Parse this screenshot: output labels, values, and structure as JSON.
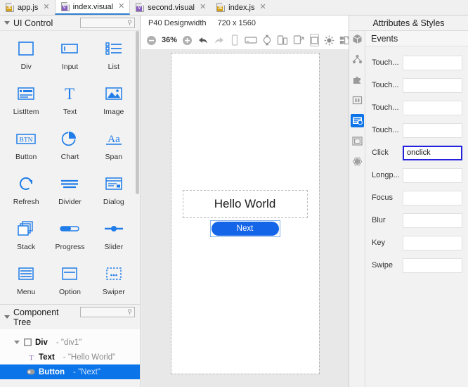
{
  "tabs": [
    {
      "label": "app.js",
      "icon": "js-file-icon",
      "badge": "JS",
      "active": false
    },
    {
      "label": "index.visual",
      "icon": "visual-file-icon",
      "badge": "V",
      "active": true
    },
    {
      "label": "second.visual",
      "icon": "visual-file-icon",
      "badge": "V",
      "active": false
    },
    {
      "label": "index.js",
      "icon": "js-file-icon",
      "badge": "JS",
      "active": false
    }
  ],
  "left_panel": {
    "title": "UI Control",
    "search_placeholder": "",
    "controls": [
      {
        "name": "Div",
        "icon": "div-icon"
      },
      {
        "name": "Input",
        "icon": "input-icon"
      },
      {
        "name": "List",
        "icon": "list-icon"
      },
      {
        "name": "ListItem",
        "icon": "listitem-icon"
      },
      {
        "name": "Text",
        "icon": "text-icon"
      },
      {
        "name": "Image",
        "icon": "image-icon"
      },
      {
        "name": "Button",
        "icon": "button-icon"
      },
      {
        "name": "Chart",
        "icon": "chart-icon"
      },
      {
        "name": "Span",
        "icon": "span-icon"
      },
      {
        "name": "Refresh",
        "icon": "refresh-icon"
      },
      {
        "name": "Divider",
        "icon": "divider-icon"
      },
      {
        "name": "Dialog",
        "icon": "dialog-icon"
      },
      {
        "name": "Stack",
        "icon": "stack-icon"
      },
      {
        "name": "Progress",
        "icon": "progress-icon"
      },
      {
        "name": "Slider",
        "icon": "slider-icon"
      },
      {
        "name": "Menu",
        "icon": "menu-icon"
      },
      {
        "name": "Option",
        "icon": "option-icon"
      },
      {
        "name": "Swiper",
        "icon": "swiper-icon"
      },
      {
        "name": "",
        "icon": "toolbar-icon"
      },
      {
        "name": "",
        "icon": "popup-icon"
      },
      {
        "name": "",
        "icon": "gauge-icon"
      }
    ]
  },
  "component_tree": {
    "title": "Component Tree",
    "search_placeholder": "",
    "rows": [
      {
        "type": "Div",
        "value": "- \"div1\"",
        "icon": "div-node-icon",
        "indent": 0,
        "selected": false,
        "has_caret": true
      },
      {
        "type": "Text",
        "value": "- \"Hello World\"",
        "icon": "text-node-icon",
        "indent": 1,
        "selected": false,
        "has_caret": false
      },
      {
        "type": "Button",
        "value": "- \"Next\"",
        "icon": "button-node-icon",
        "indent": 1,
        "selected": true,
        "has_caret": false
      }
    ]
  },
  "center": {
    "device_name": "P40 Designwidth",
    "device_size": "720 x 1560",
    "zoom": "36%",
    "toolbar": [
      {
        "name": "zoom-out-button",
        "icon": "minus-circle-icon"
      },
      {
        "name": "zoom-level",
        "icon": "zoom-label"
      },
      {
        "name": "zoom-in-button",
        "icon": "plus-circle-icon"
      },
      {
        "name": "undo-button",
        "icon": "undo-arrow-icon"
      },
      {
        "name": "redo-button",
        "icon": "redo-arrow-icon"
      },
      {
        "name": "phone-portrait-button",
        "icon": "phone-portrait-icon"
      },
      {
        "name": "phone-landscape-button",
        "icon": "phone-landscape-icon"
      },
      {
        "name": "watch-button",
        "icon": "watch-icon"
      },
      {
        "name": "foldable-button",
        "icon": "foldable-phone-icon"
      },
      {
        "name": "multi-screen-button",
        "icon": "multi-screen-icon"
      },
      {
        "name": "fullscreen-button",
        "icon": "square-outline-icon"
      },
      {
        "name": "brightness-button",
        "icon": "sun-icon"
      },
      {
        "name": "layout-button",
        "icon": "layout-grid-icon"
      }
    ],
    "preview": {
      "text_label": "Hello World",
      "button_label": "Next"
    }
  },
  "right_panel": {
    "title": "Attributes & Styles",
    "rail": [
      {
        "name": "component-icon",
        "active": false
      },
      {
        "name": "structure-icon",
        "active": false
      },
      {
        "name": "puzzle-icon",
        "active": false
      },
      {
        "name": "columns-icon",
        "active": false
      },
      {
        "name": "events-icon",
        "active": true
      },
      {
        "name": "frame-icon",
        "active": false
      },
      {
        "name": "atom-icon",
        "active": false
      }
    ],
    "section_title": "Events",
    "fields": [
      {
        "label": "Touch...",
        "value": "",
        "focused": false
      },
      {
        "label": "Touch...",
        "value": "",
        "focused": false
      },
      {
        "label": "Touch...",
        "value": "",
        "focused": false
      },
      {
        "label": "Touch...",
        "value": "",
        "focused": false
      },
      {
        "label": "Click",
        "value": "onclick",
        "focused": true
      },
      {
        "label": "Longp...",
        "value": "",
        "focused": false
      },
      {
        "label": "Focus",
        "value": "",
        "focused": false
      },
      {
        "label": "Blur",
        "value": "",
        "focused": false
      },
      {
        "label": "Key",
        "value": "",
        "focused": false
      },
      {
        "label": "Swipe",
        "value": "",
        "focused": false
      }
    ]
  },
  "colors": {
    "accent_blue": "#0b74e8",
    "control_blue": "#1f7ce8",
    "panel_bg": "#f2f2f2",
    "canvas_bg": "#e8e8e8",
    "focus_border": "#2222dd"
  }
}
